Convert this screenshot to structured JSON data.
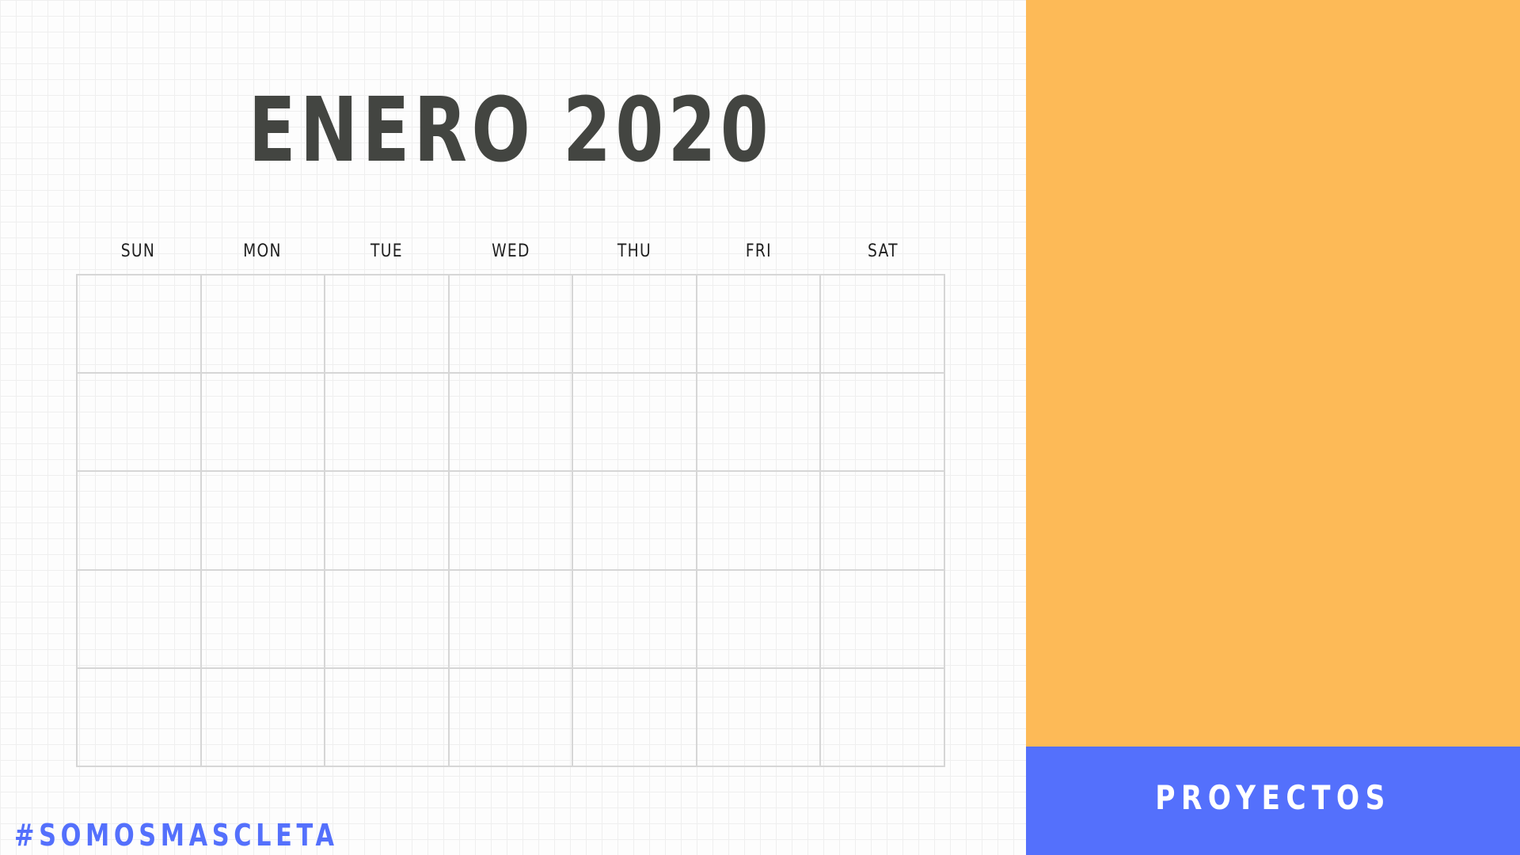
{
  "calendar": {
    "title": "ENERO 2020",
    "weekdays": [
      "SUN",
      "MON",
      "TUE",
      "WED",
      "THU",
      "FRI",
      "SAT"
    ],
    "week_rows": 5
  },
  "footer": {
    "hashtag": "#SOMOSMASCLETA"
  },
  "side_panel": {
    "band_label": "PROYECTOS"
  },
  "colors": {
    "title_text": "#434541",
    "accent_orange": "#fdba57",
    "accent_blue": "#5470fc",
    "grid_line": "#d6d6d6",
    "band_text": "#ffffff"
  }
}
